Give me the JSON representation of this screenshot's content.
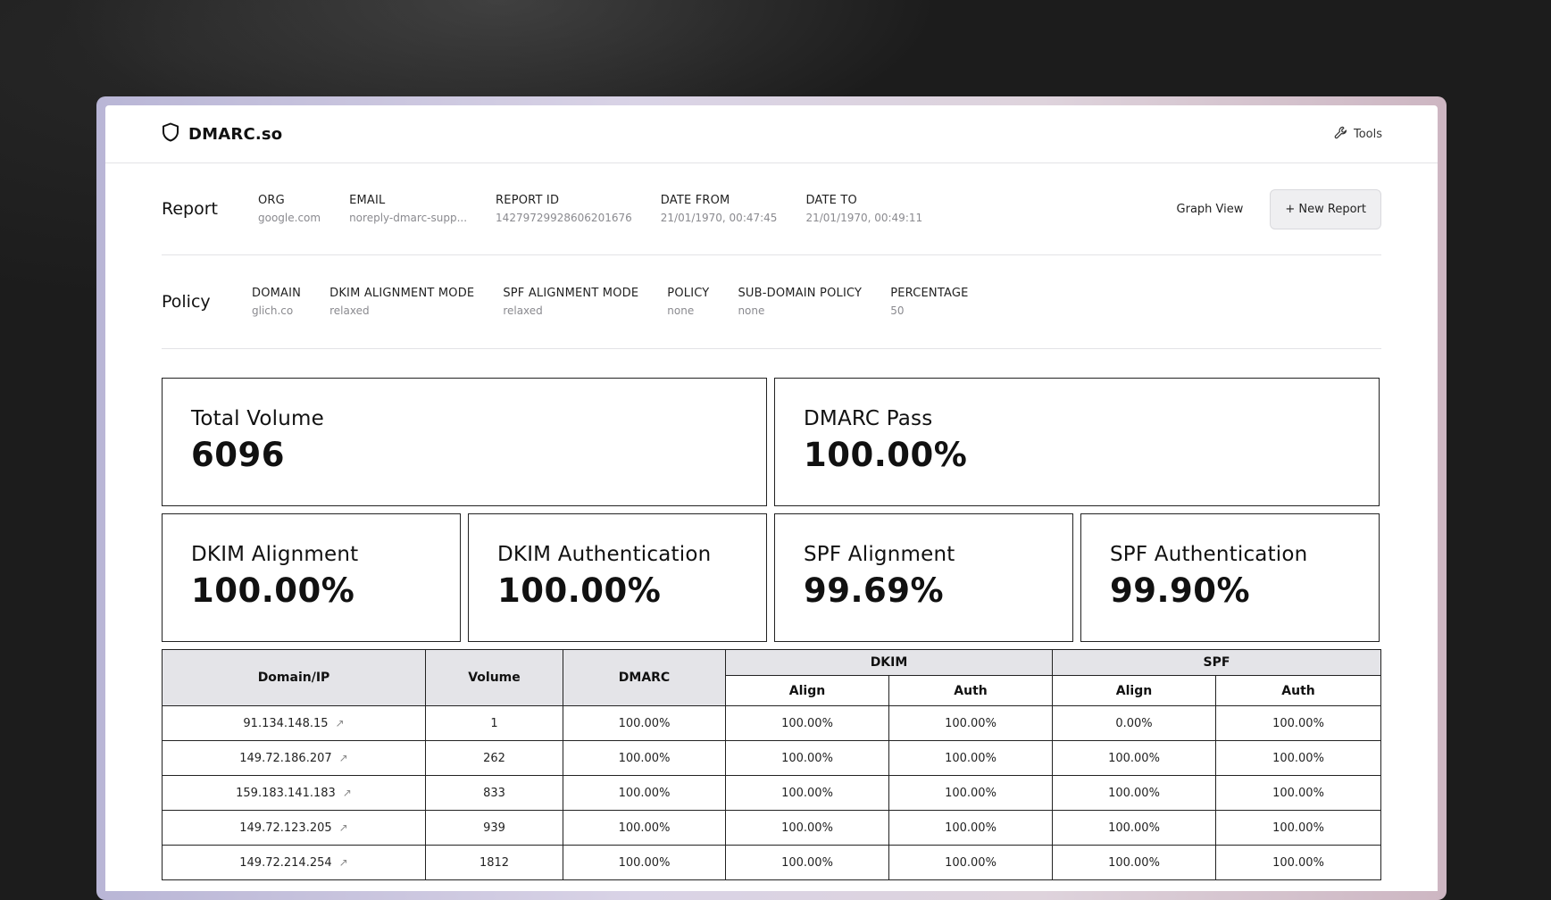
{
  "app": {
    "name": "DMARC.so",
    "tools_label": "Tools"
  },
  "report": {
    "title": "Report",
    "fields": [
      {
        "label": "ORG",
        "value": "google.com"
      },
      {
        "label": "EMAIL",
        "value": "noreply-dmarc-supp..."
      },
      {
        "label": "REPORT ID",
        "value": "14279729928606201676"
      },
      {
        "label": "DATE FROM",
        "value": "21/01/1970, 00:47:45"
      },
      {
        "label": "DATE TO",
        "value": "21/01/1970, 00:49:11"
      }
    ],
    "graph_view_label": "Graph View",
    "new_report_label": "+ New Report"
  },
  "policy": {
    "title": "Policy",
    "fields": [
      {
        "label": "DOMAIN",
        "value": "glich.co"
      },
      {
        "label": "DKIM ALIGNMENT MODE",
        "value": "relaxed"
      },
      {
        "label": "SPF ALIGNMENT MODE",
        "value": "relaxed"
      },
      {
        "label": "POLICY",
        "value": "none"
      },
      {
        "label": "SUB-DOMAIN POLICY",
        "value": "none"
      },
      {
        "label": "PERCENTAGE",
        "value": "50"
      }
    ]
  },
  "stats": {
    "total_volume": {
      "label": "Total Volume",
      "value": "6096"
    },
    "dmarc_pass": {
      "label": "DMARC Pass",
      "value": "100.00%"
    },
    "dkim_alignment": {
      "label": "DKIM Alignment",
      "value": "100.00%"
    },
    "dkim_authentication": {
      "label": "DKIM Authentication",
      "value": "100.00%"
    },
    "spf_alignment": {
      "label": "SPF Alignment",
      "value": "99.69%"
    },
    "spf_authentication": {
      "label": "SPF Authentication",
      "value": "99.90%"
    }
  },
  "table": {
    "headers": {
      "domain_ip": "Domain/IP",
      "volume": "Volume",
      "dmarc": "DMARC",
      "dkim": "DKIM",
      "spf": "SPF",
      "align": "Align",
      "auth": "Auth"
    },
    "rows": [
      {
        "ip": "91.134.148.15",
        "volume": "1",
        "dmarc": "100.00%",
        "dkim_align": "100.00%",
        "dkim_auth": "100.00%",
        "spf_align": "0.00%",
        "spf_auth": "100.00%"
      },
      {
        "ip": "149.72.186.207",
        "volume": "262",
        "dmarc": "100.00%",
        "dkim_align": "100.00%",
        "dkim_auth": "100.00%",
        "spf_align": "100.00%",
        "spf_auth": "100.00%"
      },
      {
        "ip": "159.183.141.183",
        "volume": "833",
        "dmarc": "100.00%",
        "dkim_align": "100.00%",
        "dkim_auth": "100.00%",
        "spf_align": "100.00%",
        "spf_auth": "100.00%"
      },
      {
        "ip": "149.72.123.205",
        "volume": "939",
        "dmarc": "100.00%",
        "dkim_align": "100.00%",
        "dkim_auth": "100.00%",
        "spf_align": "100.00%",
        "spf_auth": "100.00%"
      },
      {
        "ip": "149.72.214.254",
        "volume": "1812",
        "dmarc": "100.00%",
        "dkim_align": "100.00%",
        "dkim_auth": "100.00%",
        "spf_align": "100.00%",
        "spf_auth": "100.00%"
      }
    ]
  }
}
